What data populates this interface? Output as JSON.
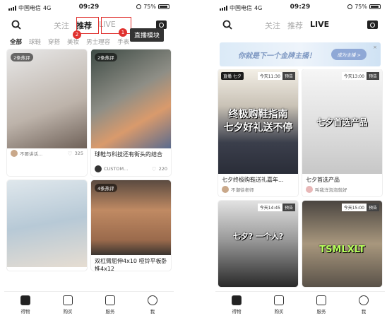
{
  "status": {
    "carrier": "中国电信",
    "network": "4G",
    "time": "09:29",
    "battery_pct": 75,
    "battery_text": "75%"
  },
  "left": {
    "tabs": [
      "关注",
      "推荐",
      "LIVE"
    ],
    "active_tab": "推荐",
    "categories": [
      "全部",
      "球鞋",
      "穿搭",
      "美妆",
      "男士理容",
      "手表"
    ],
    "annotations": {
      "badge1": "1",
      "badge2": "2",
      "tooltip": "直播模块"
    },
    "cards": [
      {
        "hot": "2条热评",
        "caption": "",
        "author": "不要讲话...",
        "likes": "325",
        "colors": [
          "#d9d9d9",
          "#7a6a5e"
        ]
      },
      {
        "hot": "2条热评",
        "caption": "球鞋与科技还有街头的结合",
        "author": "CUSTOM...",
        "likes": "220",
        "colors": [
          "#556b5a",
          "#d8a47a"
        ]
      },
      {
        "hot": "",
        "caption": "",
        "author": "",
        "likes": "",
        "colors": [
          "#c7d6e0",
          "#e9eef0"
        ]
      },
      {
        "hot": "4条热评",
        "caption": "双杠臂屈伸4x10 哑铃平板卧推4x12",
        "author": "",
        "likes": "",
        "colors": [
          "#b27c5a",
          "#4a3f39"
        ]
      }
    ]
  },
  "right": {
    "tabs": [
      "关注",
      "推荐",
      "LIVE"
    ],
    "active_tab": "LIVE",
    "banner": {
      "text": "你就是下一个金牌主播！",
      "button": "成为主播 >",
      "close": "×"
    },
    "cards": [
      {
        "live": "直播 七夕",
        "time": "今天11:30",
        "preview": "预告",
        "overlay": "终极购鞋指南\n七夕好礼送不停",
        "caption": "七夕终极购鞋送礼嘉年...",
        "author": "不潮徐老师",
        "colors": [
          "#e9e3d8",
          "#2c2f3a"
        ]
      },
      {
        "live": "",
        "time": "今天13:00",
        "preview": "预告",
        "overlay": "七夕首选产品",
        "caption": "七夕首选产品",
        "author": "叫我洋泡泡就好",
        "colors": [
          "#f2f2f2",
          "#cfcfcf"
        ]
      },
      {
        "live": "",
        "time": "今天14:45",
        "preview": "预告",
        "overlay": "七夕? 一个人?",
        "caption": "",
        "author": "",
        "colors": [
          "#d8d8d8",
          "#2b2b2b"
        ]
      },
      {
        "live": "",
        "time": "今天15:00",
        "preview": "预告",
        "overlay": "TSMLXLT",
        "caption": "",
        "author": "",
        "colors": [
          "#3d3a36",
          "#b8a78f"
        ]
      }
    ]
  },
  "tabbar": [
    "得物",
    "购买",
    "服务",
    "我"
  ]
}
